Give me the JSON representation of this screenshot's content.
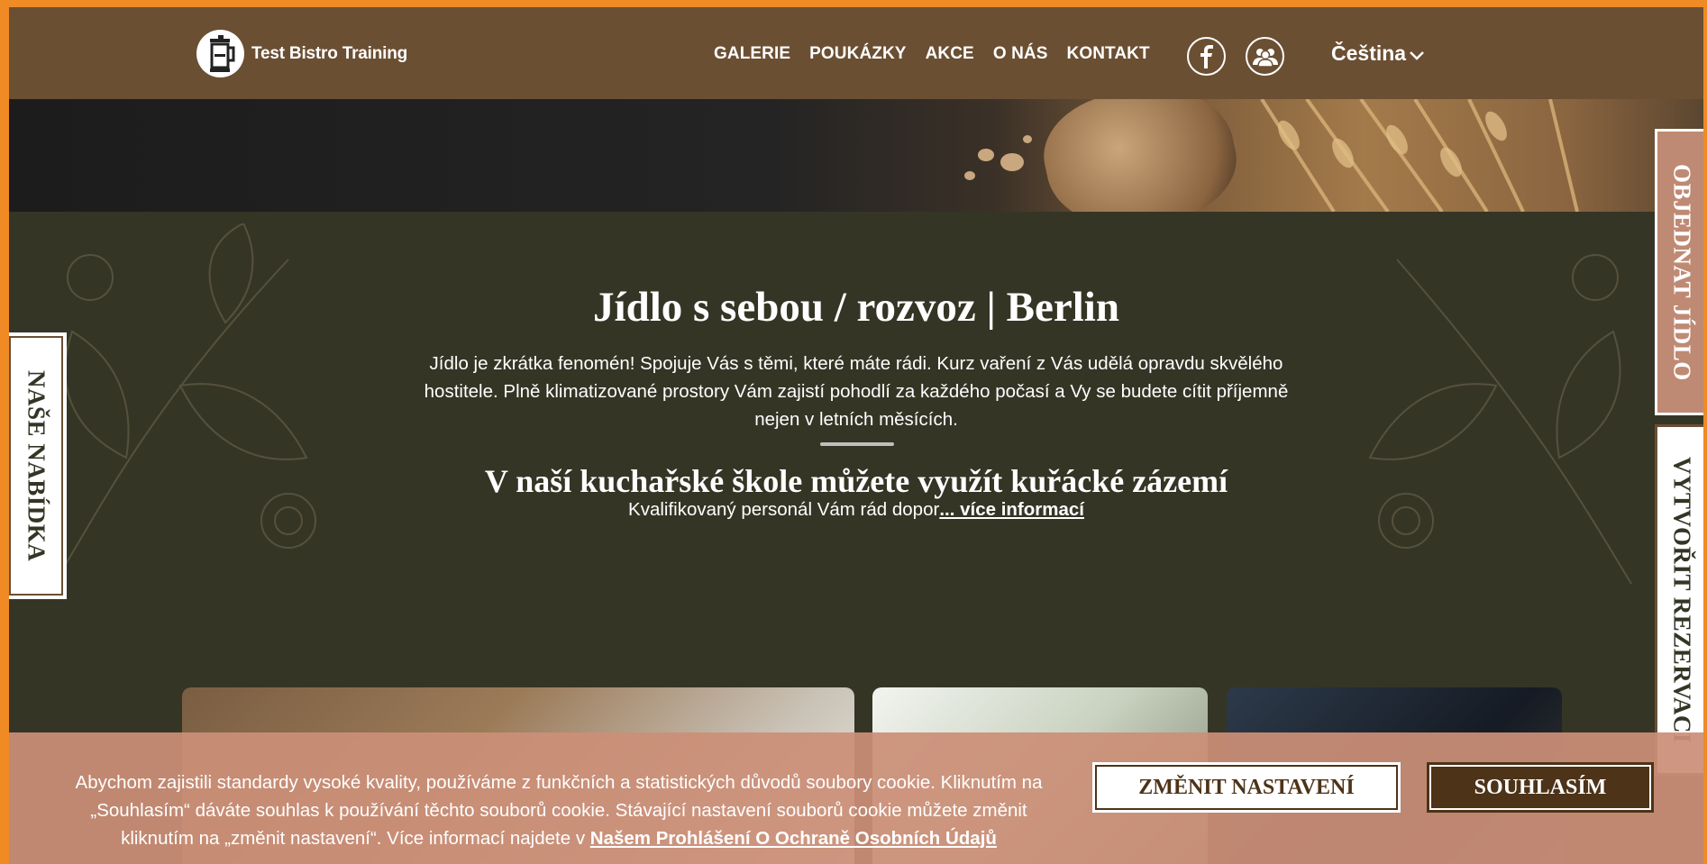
{
  "header": {
    "brand": "Test Bistro Training",
    "nav": [
      "GALERIE",
      "POUKÁZKY",
      "AKCE",
      "O NÁS",
      "KONTAKT"
    ],
    "language": "Čeština",
    "social_icons": [
      "facebook-icon",
      "community-icon"
    ]
  },
  "main": {
    "title": "Jídlo s sebou / rozvoz | Berlin",
    "description": "Jídlo je zkrátka fenomén! Spojuje Vás s těmi, které máte rádi. Kurz vaření z Vás udělá opravdu skvělého hostitele. Plně klimatizované prostory Vám zajistí pohodlí za každého počasí a Vy se budete cítit příjemně nejen v letních měsících.",
    "subtitle": "V naší kuchařské škole můžete využít kuřácké zázemí",
    "subtext": "Kvalifikovaný personál Vám rád dopor",
    "more_link": "... více informací"
  },
  "side_tabs": {
    "left": "NAŠE NABÍDKA",
    "right_top": "OBJEDNAT JÍDLO",
    "right_bottom": "VYTVOŘIT REZERVACI"
  },
  "cookie": {
    "text": "Abychom zajistili standardy vysoké kvality, používáme z funkčních a statistických důvodů soubory cookie. Kliknutím na „Souhlasím“ dáváte souhlas k používání těchto souborů cookie. Stávající nastavení souborů cookie můžete změnit kliknutím na „změnit nastavení“. Více informací najdete v",
    "link": "Našem Prohlášení O Ochraně Osobních Údajů",
    "change_button": "ZMĚNIT NASTAVENÍ",
    "agree_button": "SOUHLASÍM"
  },
  "colors": {
    "header_bg": "#6b4f33",
    "content_bg": "#353526",
    "cookie_bg": "#cb8f77",
    "accent_orange": "#f08a24",
    "button_dark": "#4d3318"
  }
}
